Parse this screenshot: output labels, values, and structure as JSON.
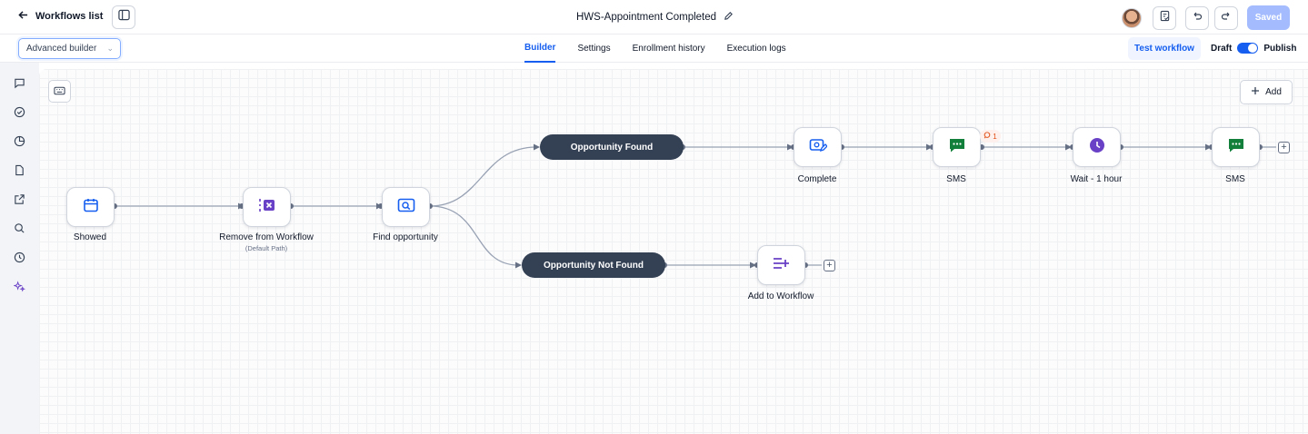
{
  "header": {
    "back_label": "Workflows list",
    "workflow_title": "HWS-Appointment Completed",
    "saved_label": "Saved"
  },
  "subbar": {
    "builder_mode": "Advanced builder",
    "tabs": [
      "Builder",
      "Settings",
      "Enrollment history",
      "Execution logs"
    ],
    "active_tab": "Builder",
    "test_label": "Test workflow",
    "draft_label": "Draft",
    "publish_label": "Publish"
  },
  "canvas": {
    "add_label": "Add",
    "nodes": {
      "showed": "Showed",
      "remove": "Remove from Workflow",
      "remove_sub": "(Default Path)",
      "find": "Find opportunity",
      "complete": "Complete",
      "sms1": "SMS",
      "wait": "Wait - 1 hour",
      "sms2": "SMS",
      "add_to_workflow": "Add to Workflow"
    },
    "branches": {
      "found": "Opportunity Found",
      "not_found": "Opportunity Not Found"
    },
    "comment_count": "1"
  },
  "colors": {
    "accent": "#155eef",
    "sms_green": "#12803a",
    "wait_purple": "#6941c6",
    "remove_purple": "#6941c6",
    "pill_dark": "#344054"
  }
}
